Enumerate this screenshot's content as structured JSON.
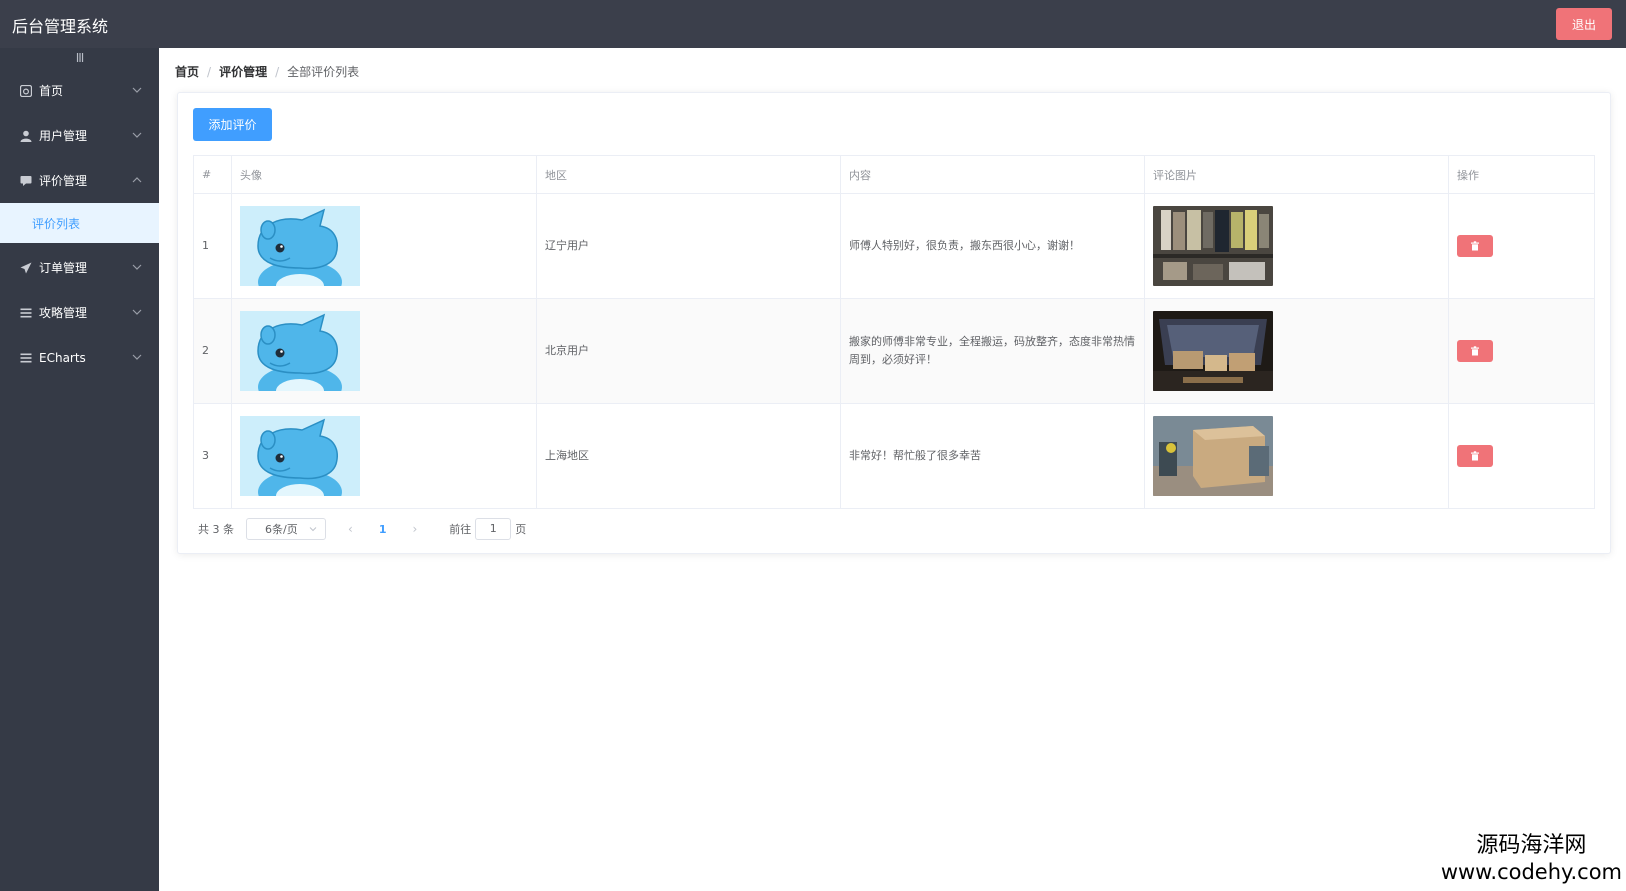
{
  "app": {
    "title": "后台管理系统",
    "logout_label": "退出"
  },
  "sidebar": {
    "collapse_glyph": "III",
    "items": [
      {
        "label": "首页",
        "icon": "dashboard-icon"
      },
      {
        "label": "用户管理",
        "icon": "user-icon"
      },
      {
        "label": "评价管理",
        "icon": "comment-icon",
        "expanded": true,
        "children": [
          {
            "label": "评价列表",
            "active": true
          }
        ]
      },
      {
        "label": "订单管理",
        "icon": "send-icon"
      },
      {
        "label": "攻略管理",
        "icon": "menu-icon"
      },
      {
        "label": "ECharts",
        "icon": "menu-icon"
      }
    ]
  },
  "breadcrumb": [
    "首页",
    "评价管理",
    "全部评价列表"
  ],
  "toolbar": {
    "add_label": "添加评价"
  },
  "table": {
    "columns": [
      "#",
      "头像",
      "地区",
      "内容",
      "评论图片",
      "操作"
    ],
    "rows": [
      {
        "index": "1",
        "region": "辽宁用户",
        "content": "师傅人特别好，很负责，搬东西很小心，谢谢！",
        "photo": "wardrobe-photo"
      },
      {
        "index": "2",
        "region": "北京用户",
        "content": "搬家的师傅非常专业，全程搬运，码放整齐，态度非常热情周到，必须好评！",
        "photo": "car-trunk-photo"
      },
      {
        "index": "3",
        "region": "上海地区",
        "content": "非常好！帮忙般了很多幸苦",
        "photo": "cardboard-box-photo"
      }
    ]
  },
  "pagination": {
    "total_text": "共 3 条",
    "page_size": "6条/页",
    "current_page": "1",
    "goto_prefix": "前往",
    "goto_value": "1",
    "goto_suffix": "页"
  },
  "watermark": {
    "name": "源码海洋网",
    "url": "www.codehy.com"
  },
  "colors": {
    "topbar": "#3b3f4b",
    "sidebar": "#353a46",
    "primary": "#409eff",
    "danger": "#f07378"
  }
}
